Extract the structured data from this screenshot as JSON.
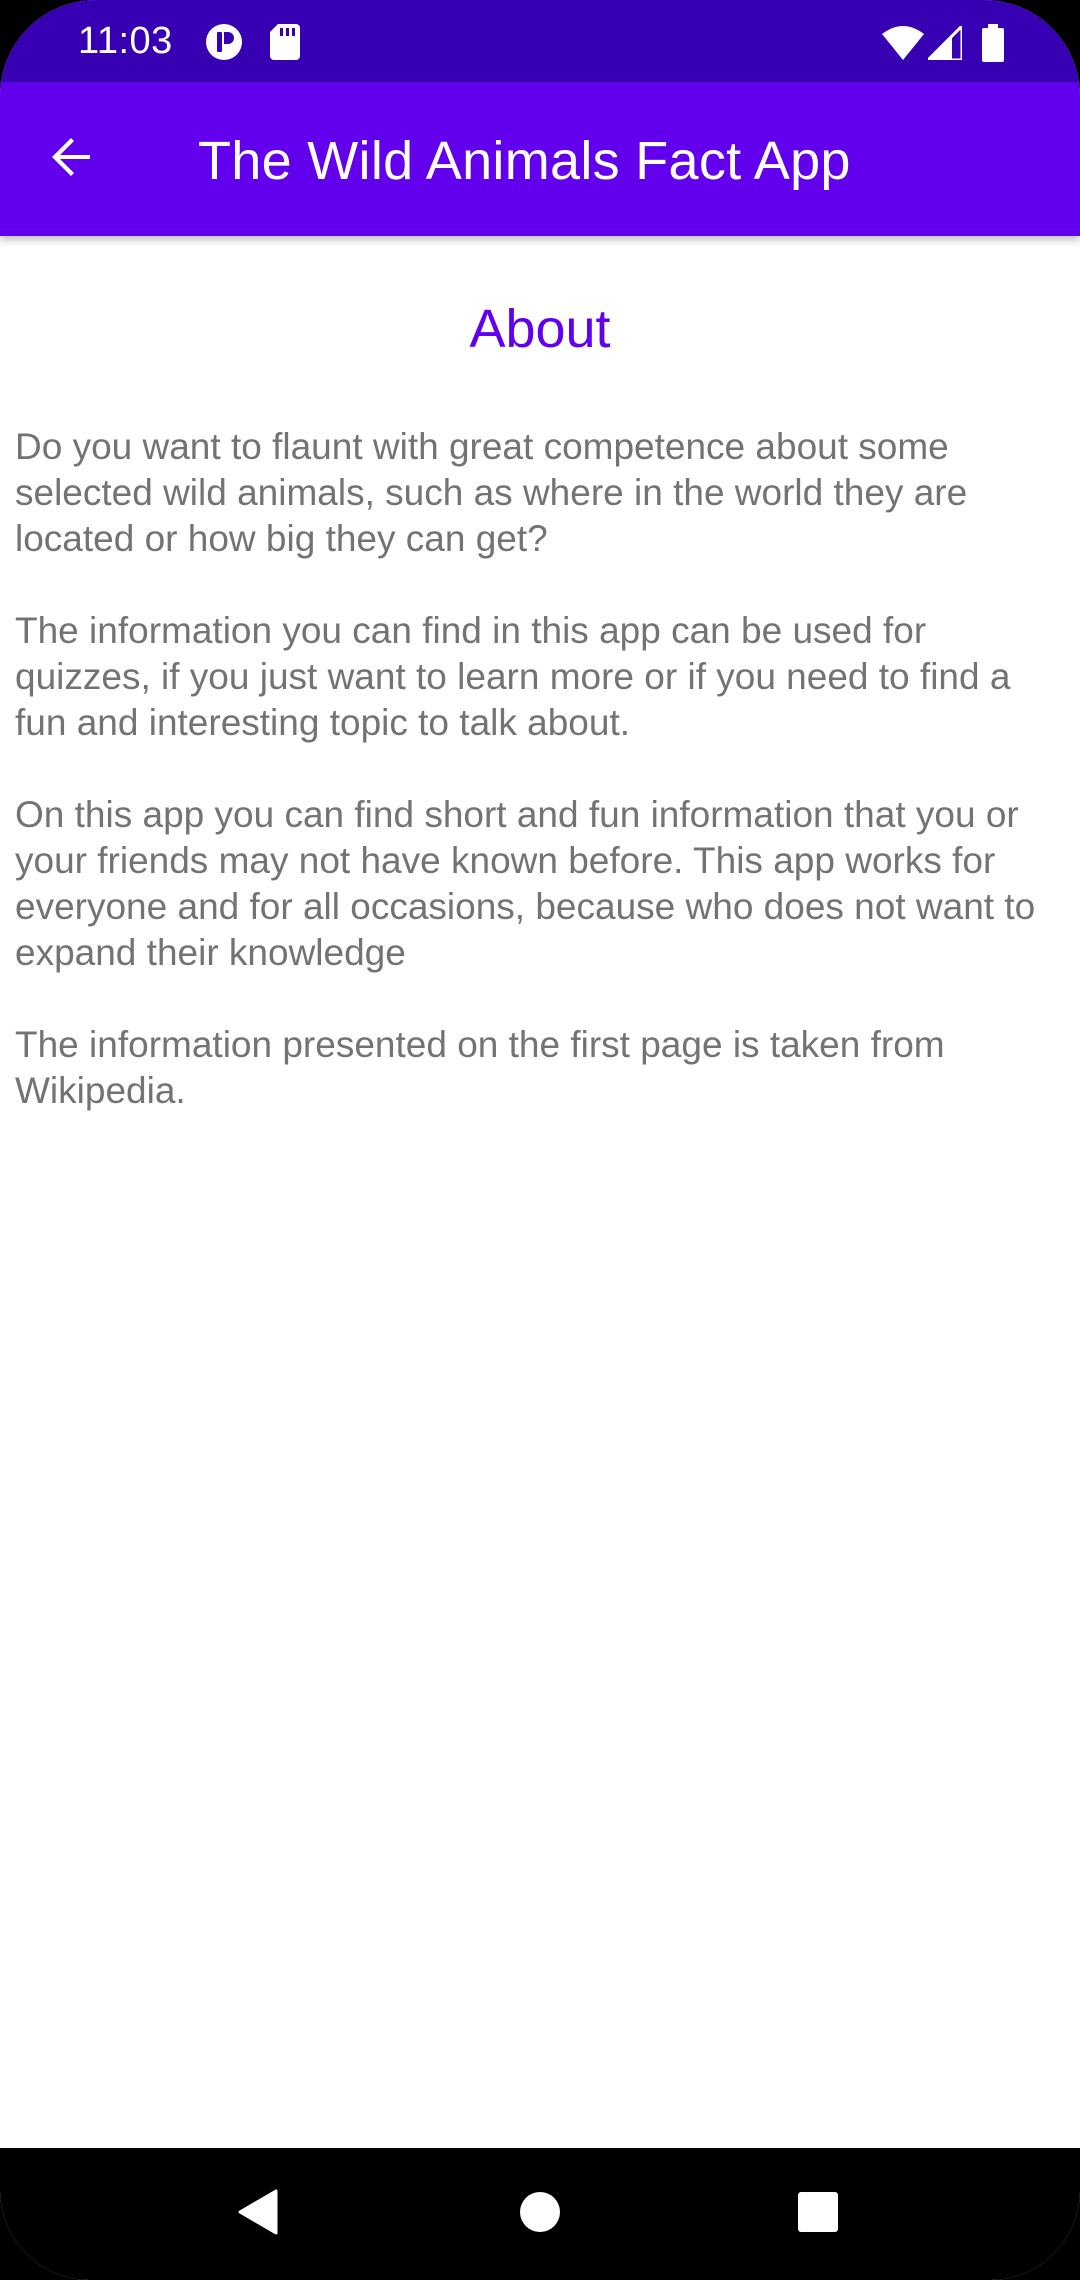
{
  "status_bar": {
    "time": "11:03",
    "icons": [
      "notification-app-icon",
      "sd-card-icon",
      "wifi-icon",
      "signal-icon",
      "battery-icon"
    ]
  },
  "app_bar": {
    "title": "The Wild Animals Fact App",
    "back_icon": "arrow-back-icon"
  },
  "about": {
    "heading": "About",
    "paragraphs": [
      "Do you want to flaunt with great competence about some selected wild animals, such as where in the world they are located or how big they can get?",
      "The information you can find in this app can be used for quizzes, if you just want to learn more or if you need to find a fun and interesting topic to talk about.",
      "On this app you can find short and fun information that you or your friends may not have known before. This app works for everyone and for all occasions, because who does not want to expand their knowledge",
      "The information presented on the first page is taken from Wikipedia."
    ]
  },
  "nav_bar": {
    "buttons": [
      "back-nav-icon",
      "home-nav-icon",
      "recents-nav-icon"
    ]
  },
  "colors": {
    "status_bar": "#3700b3",
    "app_bar": "#6200ee",
    "heading": "#6200ee",
    "body_text": "#737373"
  }
}
